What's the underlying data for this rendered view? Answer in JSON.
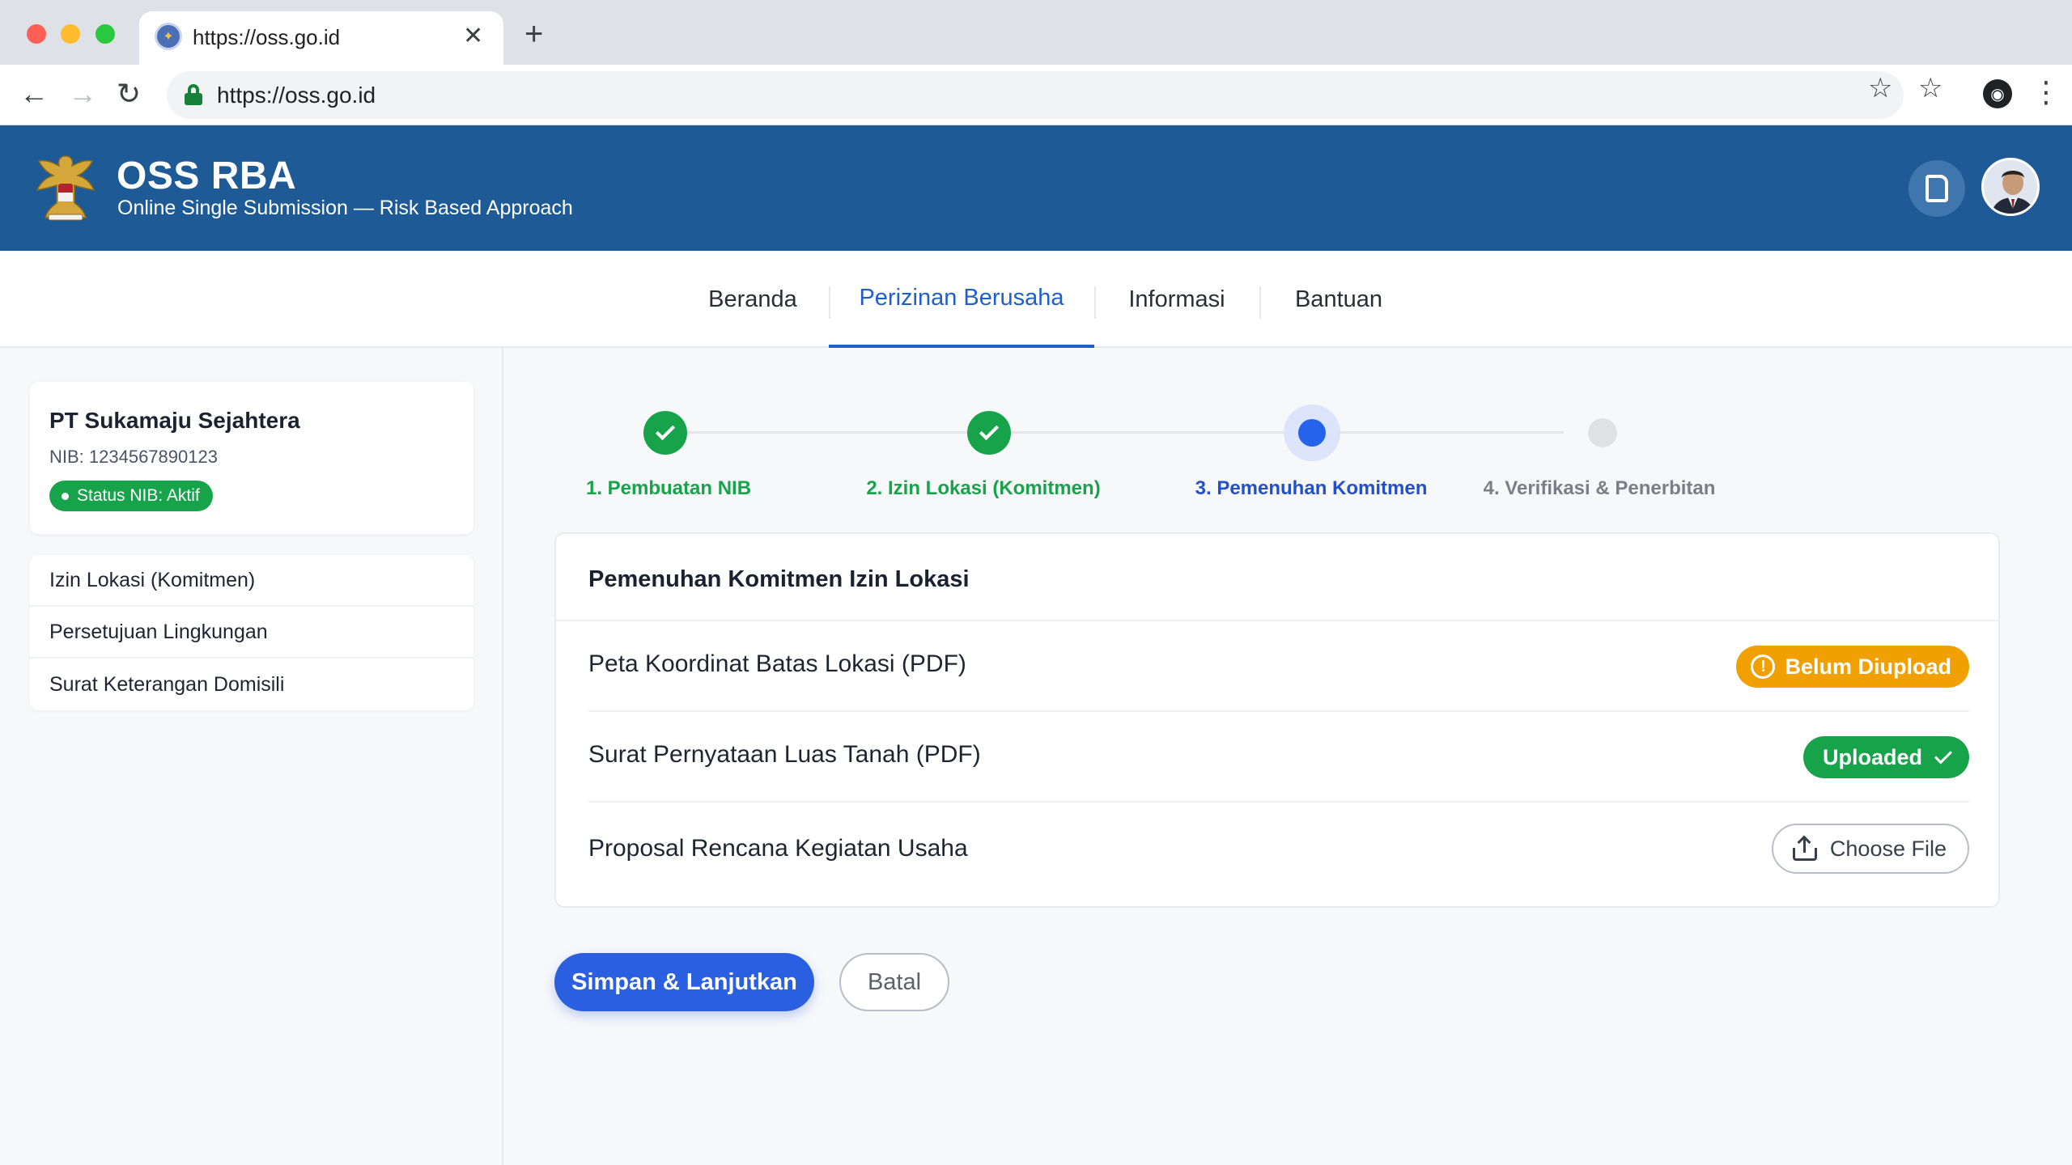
{
  "browser": {
    "tab_title": "https://oss.go.id",
    "url": "https://oss.go.id"
  },
  "header": {
    "title": "OSS RBA",
    "subtitle": "Online Single Submission — Risk Based Approach"
  },
  "nav": {
    "items": [
      {
        "label": "Beranda"
      },
      {
        "label": "Perizinan Berusaha",
        "active": true
      },
      {
        "label": "Informasi"
      },
      {
        "label": "Bantuan"
      }
    ]
  },
  "company": {
    "name": "PT Sukamaju Sejahtera",
    "nib": "NIB: 1234567890123",
    "status": "Status NIB: Aktif"
  },
  "sidebar": {
    "items": [
      {
        "label": "Izin Lokasi (Komitmen)"
      },
      {
        "label": "Persetujuan Lingkungan"
      },
      {
        "label": "Surat Keterangan Domisili"
      }
    ]
  },
  "stepper": {
    "steps": [
      {
        "label": "1. Pembuatan NIB",
        "state": "done"
      },
      {
        "label": "2. Izin Lokasi (Komitmen)",
        "state": "done"
      },
      {
        "label": "3. Pemenuhan Komitmen",
        "state": "current"
      },
      {
        "label": "4. Verifikasi & Penerbitan",
        "state": "pending"
      }
    ]
  },
  "card": {
    "title": "Pemenuhan Komitmen Izin Lokasi",
    "rows": [
      {
        "label": "Peta Koordinat Batas Lokasi (PDF)",
        "status": "Belum Diupload"
      },
      {
        "label": "Surat Pernyataan Luas Tanah (PDF)",
        "status": "Uploaded"
      },
      {
        "label": "Proposal Rencana Kegiatan Usaha",
        "action": "Choose File"
      }
    ]
  },
  "actions": {
    "primary": "Simpan & Lanjutkan",
    "secondary": "Batal"
  },
  "colors": {
    "header_bg": "#1d5a96",
    "accent": "#2a5fe0",
    "success": "#16a34a",
    "warning": "#f0a000"
  }
}
